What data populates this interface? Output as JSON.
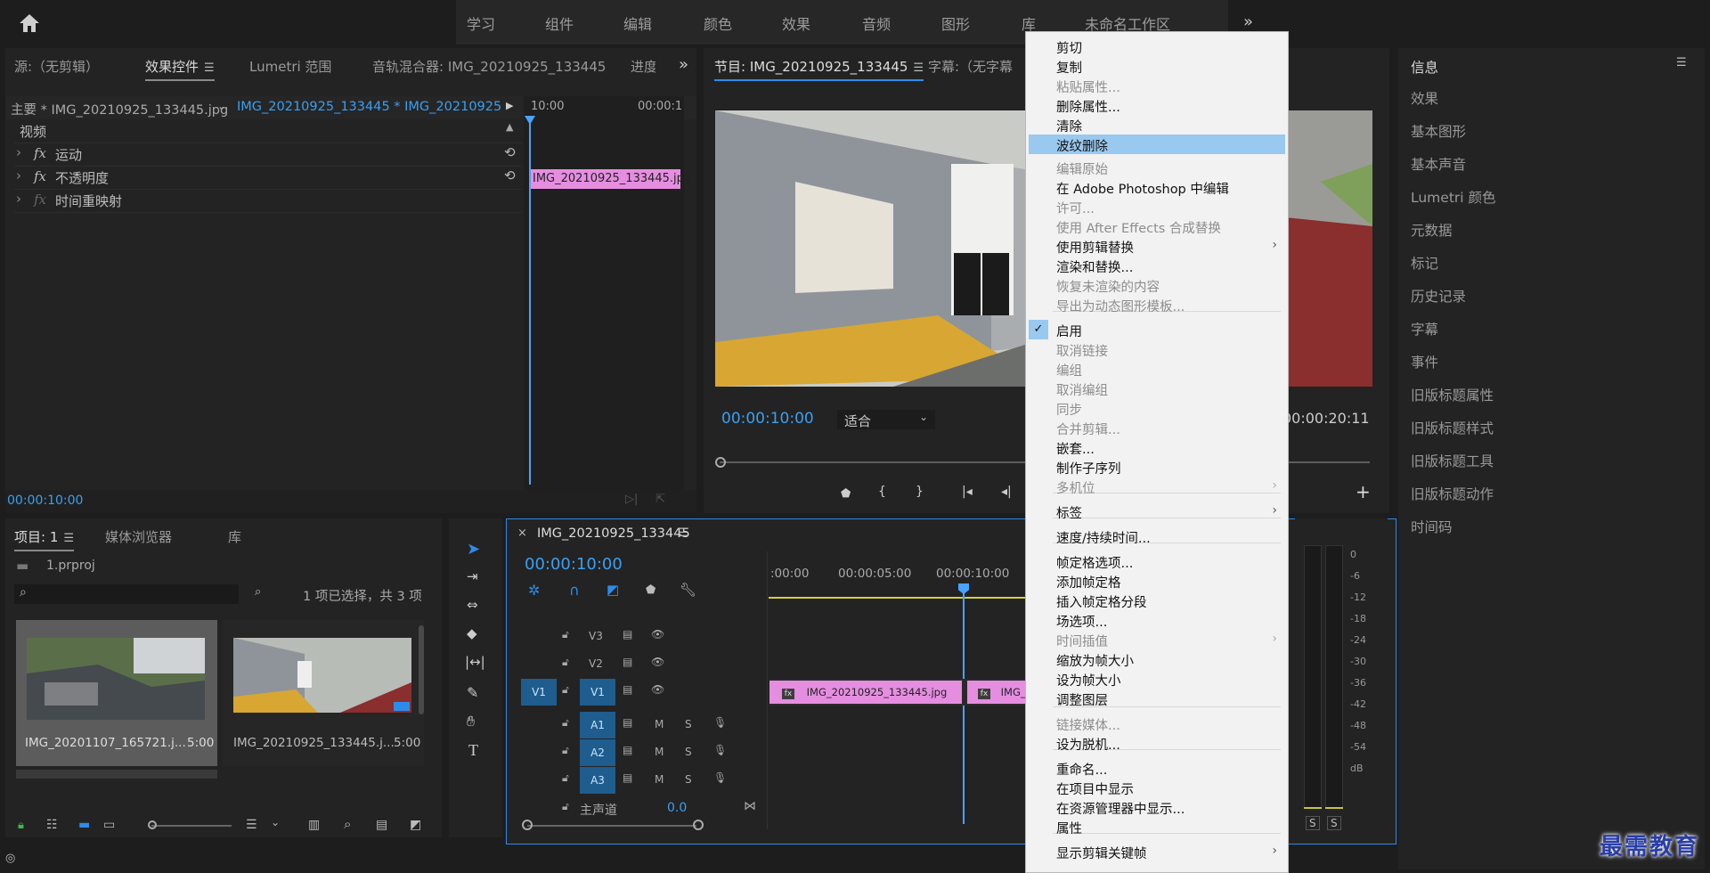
{
  "workspaces": [
    "学习",
    "组件",
    "编辑",
    "颜色",
    "效果",
    "音频",
    "图形",
    "库",
    "未命名工作区"
  ],
  "source_panel": {
    "tabs": [
      "源:（无剪辑）",
      "效果控件",
      "Lumetri 范围",
      "音轨混合器: IMG_20210925_133445",
      "进度"
    ],
    "master_label": "主要 * IMG_20210925_133445.jpg",
    "sequence_label": "IMG_20210925_133445 * IMG_20210925_1...",
    "ruler_start": "10:00",
    "ruler_end": "00:00:1",
    "clip_label": "IMG_20210925_133445.jpg",
    "section": "视频",
    "effects": [
      "运动",
      "不透明度",
      "时间重映射"
    ],
    "timecode": "00:00:10:00"
  },
  "program_panel": {
    "tabs": [
      "节目: IMG_20210925_133445",
      "字幕:（无字幕"
    ],
    "timecode": "00:00:10:00",
    "fit": "适合",
    "duration": "00:00:20:11"
  },
  "info_panel": {
    "title": "信息",
    "items": [
      "效果",
      "基本图形",
      "基本声音",
      "Lumetri 颜色",
      "元数据",
      "标记",
      "历史记录",
      "字幕",
      "事件",
      "旧版标题属性",
      "旧版标题样式",
      "旧版标题工具",
      "旧版标题动作",
      "时间码"
    ]
  },
  "project_panel": {
    "tabs": [
      "项目: 1",
      "媒体浏览器",
      "库"
    ],
    "file": "1.prproj",
    "search_placeholder": "",
    "status": "1 项已选择，共 3 项",
    "items": [
      {
        "name": "IMG_20201107_165721.j...",
        "duration": "5:00"
      },
      {
        "name": "IMG_20210925_133445.j...",
        "duration": "5:00"
      }
    ]
  },
  "timeline": {
    "tab": "IMG_20210925_133445",
    "timecode": "00:00:10:00",
    "ruler": [
      ":00:00",
      "00:00:05:00",
      "00:00:10:00"
    ],
    "tracks_video": [
      "V3",
      "V2",
      "V1"
    ],
    "tracks_audio": [
      "A1",
      "A2",
      "A3"
    ],
    "source_target_v": "V1",
    "master_label": "主声道",
    "master_value": "0.0",
    "clip1": "IMG_20210925_133445.jpg",
    "clip2": "IMG_2",
    "track_m": "M",
    "track_s": "S"
  },
  "meter": {
    "scale": [
      "0",
      "-6",
      "-12",
      "-18",
      "-24",
      "-30",
      "-36",
      "-42",
      "-48",
      "-54",
      "dB"
    ],
    "solo": [
      "S",
      "S"
    ]
  },
  "context_menu": {
    "items": [
      {
        "label": "剪切",
        "enabled": true
      },
      {
        "label": "复制",
        "enabled": true
      },
      {
        "label": "粘贴属性...",
        "enabled": false
      },
      {
        "label": "删除属性...",
        "enabled": true
      },
      {
        "label": "清除",
        "enabled": true
      },
      {
        "label": "波纹删除",
        "enabled": true,
        "highlighted": true
      },
      {
        "label": "编辑原始",
        "enabled": false
      },
      {
        "label": "在 Adobe Photoshop 中编辑",
        "enabled": true
      },
      {
        "label": "许可...",
        "enabled": false
      },
      {
        "label": "使用 After Effects 合成替换",
        "enabled": false
      },
      {
        "label": "使用剪辑替换",
        "enabled": true,
        "submenu": true
      },
      {
        "label": "渲染和替换...",
        "enabled": true
      },
      {
        "label": "恢复未渲染的内容",
        "enabled": false
      },
      {
        "label": "导出为动态图形模板...",
        "enabled": false
      },
      {
        "label": "启用",
        "enabled": true,
        "checked": true
      },
      {
        "label": "取消链接",
        "enabled": false
      },
      {
        "label": "编组",
        "enabled": false
      },
      {
        "label": "取消编组",
        "enabled": false
      },
      {
        "label": "同步",
        "enabled": false
      },
      {
        "label": "合并剪辑...",
        "enabled": false
      },
      {
        "label": "嵌套...",
        "enabled": true
      },
      {
        "label": "制作子序列",
        "enabled": true
      },
      {
        "label": "多机位",
        "enabled": false,
        "submenu": true
      },
      {
        "label": "标签",
        "enabled": true,
        "submenu": true
      },
      {
        "label": "速度/持续时间...",
        "enabled": true
      },
      {
        "label": "帧定格选项...",
        "enabled": true
      },
      {
        "label": "添加帧定格",
        "enabled": true
      },
      {
        "label": "插入帧定格分段",
        "enabled": true
      },
      {
        "label": "场选项...",
        "enabled": true
      },
      {
        "label": "时间插值",
        "enabled": false,
        "submenu": true
      },
      {
        "label": "缩放为帧大小",
        "enabled": true
      },
      {
        "label": "设为帧大小",
        "enabled": true
      },
      {
        "label": "调整图层",
        "enabled": true
      },
      {
        "label": "链接媒体...",
        "enabled": false
      },
      {
        "label": "设为脱机...",
        "enabled": true
      },
      {
        "label": "重命名...",
        "enabled": true
      },
      {
        "label": "在项目中显示",
        "enabled": true
      },
      {
        "label": "在资源管理器中显示...",
        "enabled": true
      },
      {
        "label": "属性",
        "enabled": true
      },
      {
        "label": "显示剪辑关键帧",
        "enabled": true,
        "submenu": true
      }
    ]
  },
  "watermark": "最需教育",
  "colors": {
    "accent": "#2d8ceb",
    "clip": "#e58ee0",
    "highlight": "#99c9ef",
    "track_target": "#1f5d8e",
    "playhead": "#4aa3ff"
  }
}
